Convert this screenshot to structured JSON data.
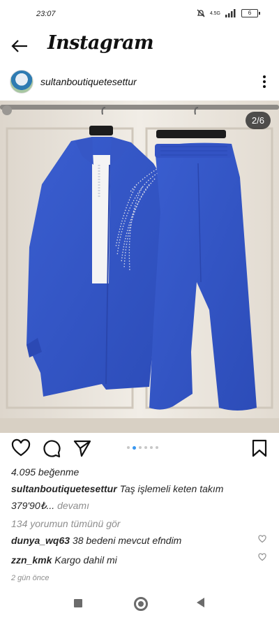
{
  "status_bar": {
    "time": "23:07",
    "network": "4.5G",
    "battery": "6"
  },
  "header": {
    "title": "Instagram"
  },
  "post": {
    "username": "sultanboutiquetesettur",
    "page_indicator": "2/6",
    "likes": "4.095 beğenme",
    "caption_user": "sultanboutiquetesettur",
    "caption_text": "Taş işlemeli keten takım",
    "caption_price": "379'90₺...",
    "more_label": "devamı",
    "view_comments": "134 yorumun tümünü gör",
    "comments": [
      {
        "user": "dunya_wq63",
        "text": "38 bedeni mevcut efndim"
      },
      {
        "user": "zzn_kmk",
        "text": "Kargo dahil mi"
      }
    ],
    "time_ago": "2 gün önce"
  },
  "colors": {
    "accent": "#3897f0",
    "garment": "#3a5fd0"
  }
}
